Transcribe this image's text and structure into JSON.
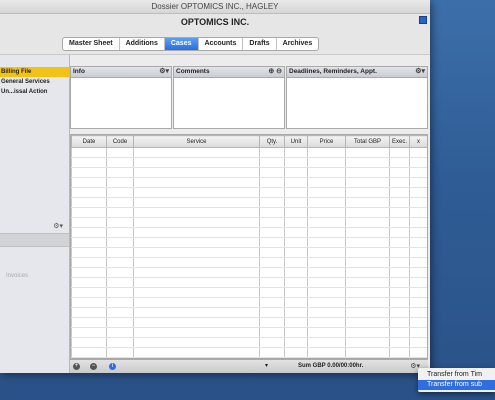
{
  "window": {
    "title": "Dossier OPTOMICS INC., HAGLEY",
    "company": "OPTOMICS INC."
  },
  "tabs": [
    "Master Sheet",
    "Additions",
    "Cases",
    "Accounts",
    "Drafts",
    "Archives"
  ],
  "active_tab": "Cases",
  "sidebar": {
    "items": [
      "Billing File",
      "General Services",
      "Un...issal Action"
    ],
    "selected": "Billing File",
    "lower_label": "Invoices"
  },
  "panels": {
    "info": "Info",
    "comments": "Comments",
    "deadlines": "Deadlines, Reminders, Appt."
  },
  "table": {
    "columns": [
      "Date",
      "Code",
      "Service",
      "Qty.",
      "Unit",
      "Price",
      "Total GBP",
      "Exec.",
      "x"
    ]
  },
  "statusbar": {
    "sum": "Sum GBP 0.00/00:00hr."
  },
  "menu": {
    "items": [
      "Transfer from Tim",
      "Transfer from sub"
    ],
    "highlighted": "Transfer from sub"
  },
  "colors": {
    "tab_active": "#2a6ee0",
    "selection": "#f2c316",
    "menu_highlight": "#2f6ee0"
  }
}
